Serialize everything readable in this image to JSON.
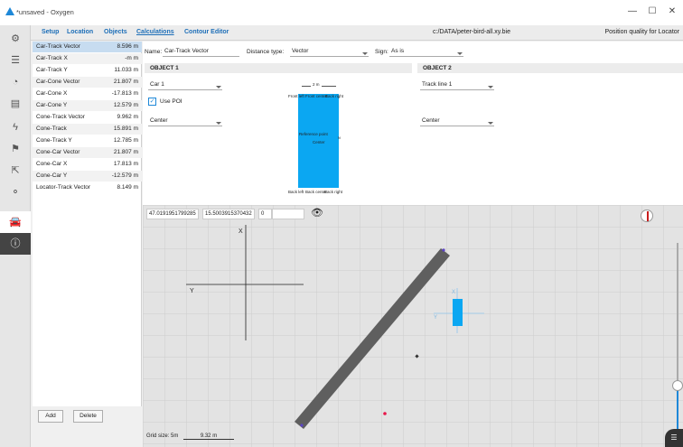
{
  "window": {
    "title": "*unsaved - Oxygen",
    "minimize_glyph": "—",
    "maximize_glyph": "☐",
    "close_glyph": "✕"
  },
  "nav": {
    "tabs": [
      "Setup",
      "Location",
      "Objects",
      "Calculations",
      "Contour Editor"
    ],
    "active": "Calculations",
    "path": "c:/DATA/peter-bird-all.xy.bie",
    "quality": "Position quality for Locator"
  },
  "sidebar_icons": [
    "gear-icon",
    "list-icon",
    "gauge-icon",
    "document-icon",
    "lightning-icon",
    "flag-icon",
    "export-icon",
    "hierarchy-icon",
    "car-icon",
    "info-icon"
  ],
  "calculations": [
    {
      "name": "Car-Track Vector",
      "value": "8.596 m"
    },
    {
      "name": "Car-Track X",
      "value": "-m m"
    },
    {
      "name": "Car-Track Y",
      "value": "11.033 m"
    },
    {
      "name": "Car-Cone Vector",
      "value": "21.807 m"
    },
    {
      "name": "Car-Cone X",
      "value": "-17.813 m"
    },
    {
      "name": "Car-Cone Y",
      "value": "12.579 m"
    },
    {
      "name": "Cone-Track Vector",
      "value": "9.962 m"
    },
    {
      "name": "Cone-Track",
      "value": "15.891 m"
    },
    {
      "name": "Cone-Track Y",
      "value": "12.785 m"
    },
    {
      "name": "Cone-Car Vector",
      "value": "21.807 m"
    },
    {
      "name": "Cone-Car X",
      "value": "17.813 m"
    },
    {
      "name": "Cone-Car Y",
      "value": "-12.579 m"
    },
    {
      "name": "Locator-Track Vector",
      "value": "8.149 m"
    }
  ],
  "buttons": {
    "add": "Add",
    "delete": "Delete"
  },
  "editor": {
    "name_label": "Name:",
    "name_value": "Car-Track Vector",
    "distance_label": "Distance type:",
    "distance_value": "Vector",
    "sign_label": "Sign:",
    "sign_value": "As is",
    "object1": {
      "header": "OBJECT 1",
      "object": "Car 1",
      "use_poi_label": "Use POI",
      "use_poi_checked": true,
      "point": "Center"
    },
    "object2": {
      "header": "OBJECT 2",
      "object": "Track line 1",
      "point": "Center"
    },
    "car_diagram": {
      "width_label": "2 m",
      "length_label": "3",
      "front_left": "Front left",
      "front_center": "Front center",
      "front_right": "Back right",
      "reference_point": "Reference point",
      "center": "Center",
      "back_left": "Back left",
      "back_center": "Back center",
      "back_right": "Back right"
    }
  },
  "map": {
    "field1": "47.0191951799285",
    "field2": "15.5003915370432",
    "field3": "0",
    "field4": "",
    "grid_size_label": "Grid size: 5m",
    "scale_label": "9.32 m",
    "axis_x": "X",
    "axis_y": "Y",
    "car_axis_x": "X",
    "car_axis_y": "Y",
    "track_color": "#5f5f5f",
    "car_color": "#0ba7f2",
    "poi_color": "#e8174a",
    "slider_color": "#1e88d8"
  },
  "colors": {
    "accent": "#1e88d8",
    "selected_row": "#c7dcf0"
  }
}
